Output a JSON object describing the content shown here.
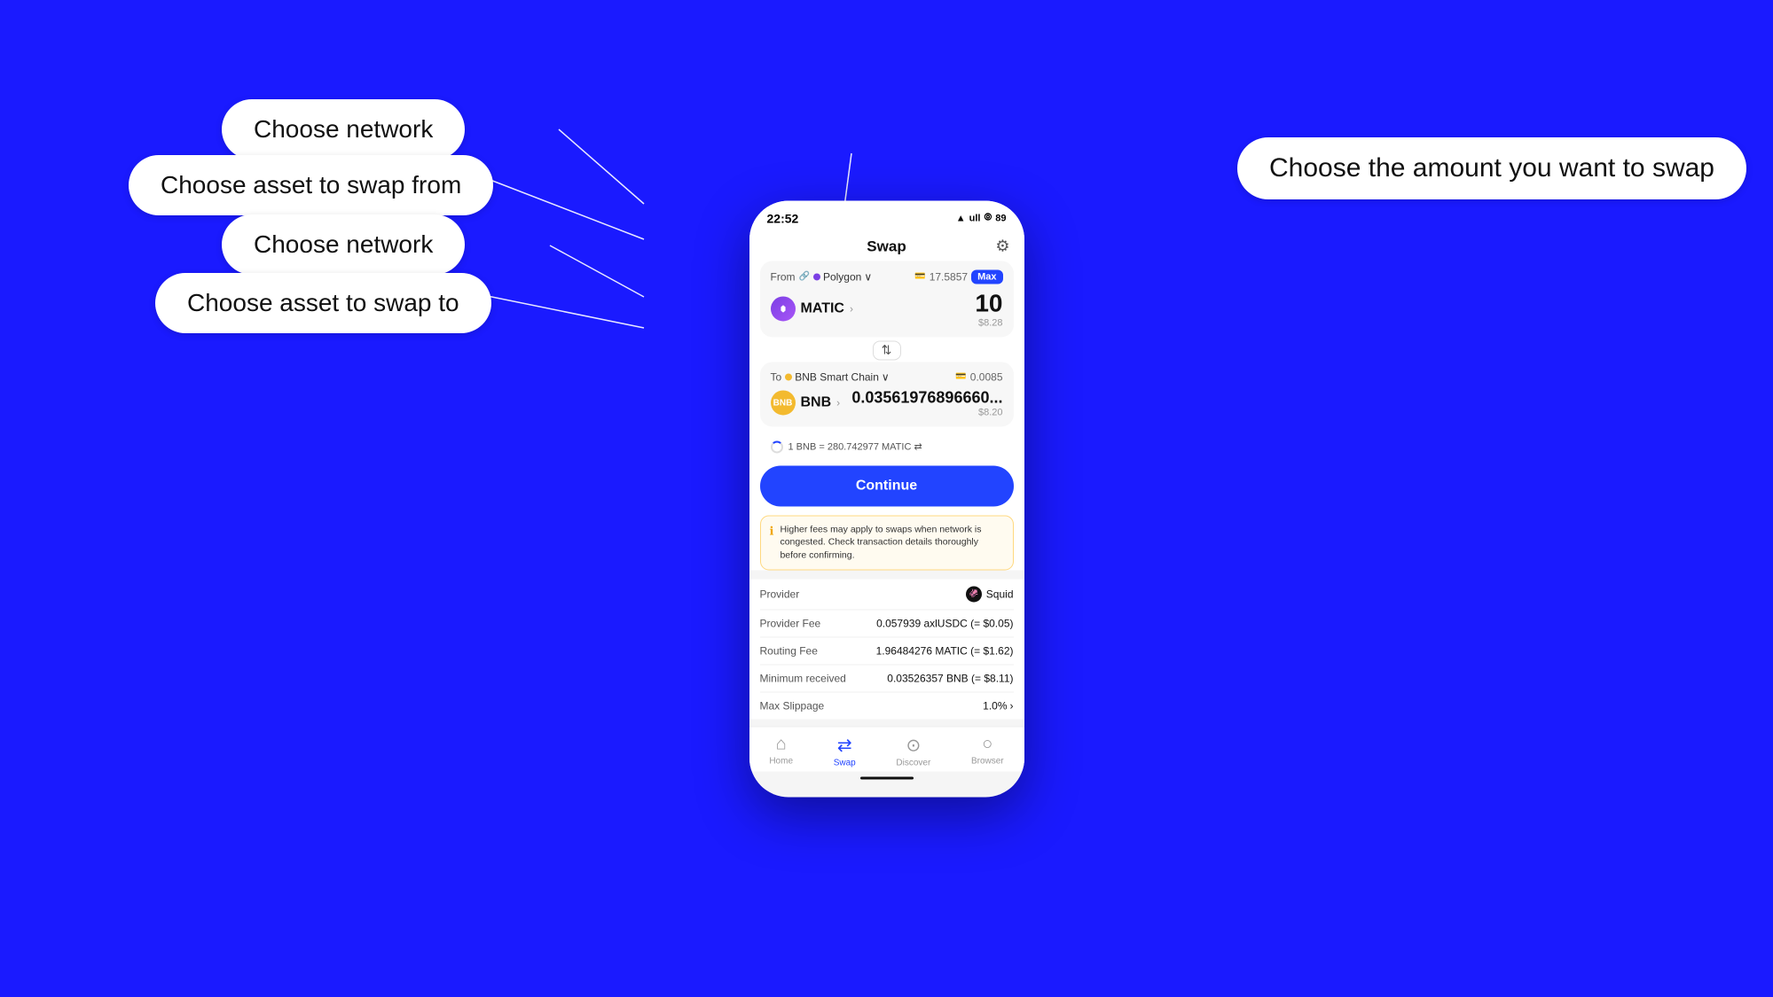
{
  "background": "#1a1aff",
  "callouts": {
    "choose_network_top": "Choose network",
    "choose_asset_from": "Choose asset to swap from",
    "choose_network_bottom": "Choose network",
    "choose_asset_to": "Choose asset to swap to",
    "choose_amount": "Choose the amount you want to swap"
  },
  "phone": {
    "status_bar": {
      "time": "22:52",
      "icons": "▲ ull ⦾ 89"
    },
    "header": {
      "title": "Swap",
      "gear_icon": "⚙"
    },
    "from_panel": {
      "label": "From",
      "network": "Polygon",
      "balance": "17.5857",
      "max_label": "Max",
      "asset_name": "MATIC",
      "amount": "10",
      "usd_value": "$8.28"
    },
    "swap_arrow": "⇅",
    "to_panel": {
      "label": "To",
      "network": "BNB Smart Chain",
      "balance": "0.0085",
      "asset_name": "BNB",
      "amount": "0.03561976896660...",
      "usd_value": "$8.20"
    },
    "exchange_rate": "1 BNB = 280.742977 MATIC ⇄",
    "continue_button": "Continue",
    "warning": "Higher fees may apply to swaps when network is congested. Check transaction details thoroughly before confirming.",
    "details": {
      "provider_label": "Provider",
      "provider_value": "Squid",
      "provider_fee_label": "Provider Fee",
      "provider_fee_value": "0.057939 axlUSDC (= $0.05)",
      "routing_fee_label": "Routing Fee",
      "routing_fee_value": "1.96484276 MATIC (= $1.62)",
      "min_received_label": "Minimum received",
      "min_received_value": "0.03526357 BNB (= $8.11)",
      "max_slippage_label": "Max Slippage",
      "max_slippage_value": "1.0%"
    },
    "bottom_nav": {
      "home": "Home",
      "swap": "Swap",
      "discover": "Discover",
      "browser": "Browser"
    }
  }
}
